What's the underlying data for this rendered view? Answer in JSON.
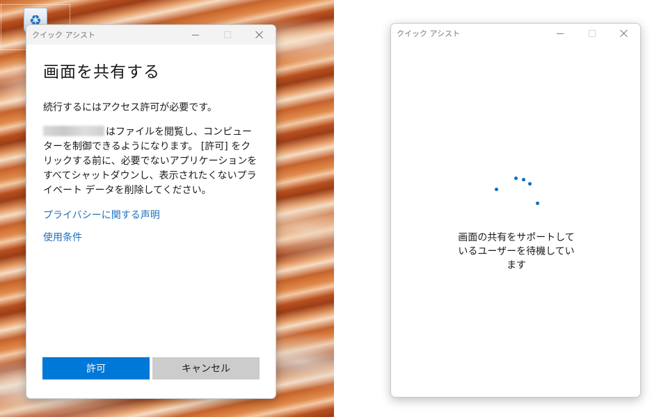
{
  "left_window": {
    "title": "クイック アシスト",
    "heading": "画面を共有する",
    "subtext": "続行するにはアクセス許可が必要です。",
    "paragraph": "はファイルを閲覧し、コンピューターを制御できるようになります。 [許可] をクリックする前に、必要でないアプリケーションをすべてシャットダウンし、表示されたくないプライベート データを削除してください。",
    "privacy_link": "プライバシーに関する声明",
    "terms_link": "使用条件",
    "allow_label": "許可",
    "cancel_label": "キャンセル"
  },
  "right_window": {
    "title": "クイック アシスト",
    "waiting_line1": "画面の共有をサポートして",
    "waiting_line2": "いるユーザーを待機してい",
    "waiting_line3": "ます"
  },
  "desktop": {
    "icons": [
      "recycle-bin-icon"
    ]
  },
  "colors": {
    "accent": "#0078d7",
    "link": "#1f6fba",
    "spinner": "#0a6cc7",
    "cancel_bg": "#cccccc"
  }
}
